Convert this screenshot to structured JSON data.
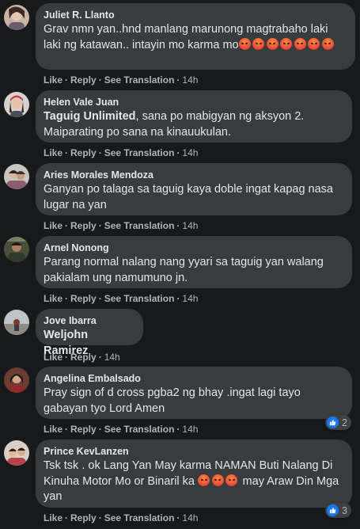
{
  "actions": {
    "like": "Like",
    "reply": "Reply",
    "translate": "See Translation",
    "time": "14h"
  },
  "comments": [
    {
      "author": "Juliet R. Llanto",
      "text": "Grav nmn yan..hnd manlang marunong magtrabaho laki laki ng katawan.. intayin mo karma mo"
    },
    {
      "author": "Helen Vale Juan",
      "tag": "Taguig Unlimited",
      "text": ", sana po mabigyan ng aksyon 2. Maiparating po sana na kinauukulan."
    },
    {
      "author": "Aries Morales Mendoza",
      "text": "Ganyan po talaga sa taguig kaya doble ingat kapag nasa lugar na yan"
    },
    {
      "author": "Arnel Nonong",
      "text": "Parang normal nalang nang yyari sa taguig yan walang pakialam ung namumuno jn."
    },
    {
      "author": "Jove Ibarra",
      "text": "Weljohn Ramirez"
    },
    {
      "author": "Angelina Embalsado",
      "text": "Pray sign of d cross pgba2 ng bhay .ingat lagi tayo gabayan tyo Lord Amen",
      "reactions": "2"
    },
    {
      "author": "Prince KevLanzen",
      "text": "Tsk tsk . ok Lang Yan May karma NAMAN Buti Nalang Di Kinuha Motor Mo or Binaril ka",
      "text_after": " may Araw Din Mga yan",
      "reactions": "3"
    }
  ],
  "colors": {
    "bubble": "#3a3b3c",
    "background": "#18191a",
    "like_blue": "#1877f2",
    "angry_emoji": "#e5483a"
  },
  "icons": {
    "reaction": "like-icon",
    "emoji": "angry-face-icon"
  }
}
